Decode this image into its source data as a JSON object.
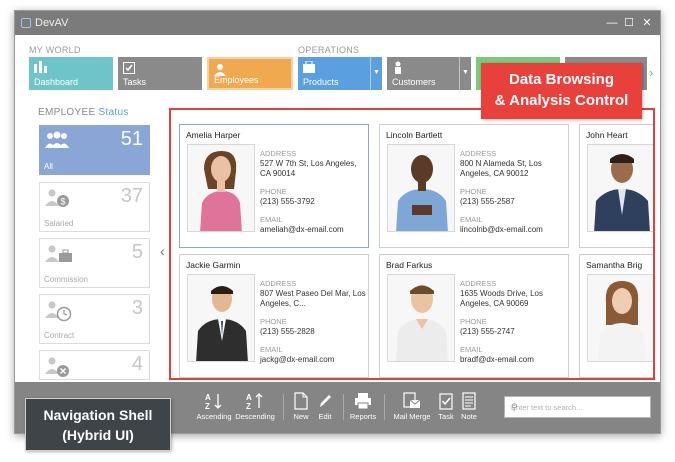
{
  "window": {
    "title": "DevAV",
    "controls": [
      "—",
      "☐",
      "✕"
    ]
  },
  "nav": {
    "groups": {
      "my_world": "MY WORLD",
      "operations": "OPERATIONS"
    },
    "tiles": [
      {
        "label": "Dashboard",
        "icon": "dashboard-icon",
        "color": "#6ec4c8"
      },
      {
        "label": "Tasks",
        "icon": "tasks-icon",
        "color": "#8a8a8a"
      },
      {
        "label": "Employees",
        "icon": "employee-icon",
        "color": "#f0a94e"
      },
      {
        "label": "Products",
        "icon": "products-icon",
        "color": "#5a9fe0"
      },
      {
        "label": "Customers",
        "icon": "customers-icon",
        "color": "#8a8a8a"
      },
      {
        "label": "",
        "icon": "sales-icon",
        "color": "#7cc87c"
      },
      {
        "label": "",
        "icon": "opportunities-icon",
        "color": "#8a8a8a"
      }
    ]
  },
  "status": {
    "title": "EMPLOYEE",
    "subtitle": "Status",
    "items": [
      {
        "label": "All",
        "count": "51",
        "icon": "group-icon"
      },
      {
        "label": "Salaried",
        "count": "37",
        "icon": "salaried-icon"
      },
      {
        "label": "Commission",
        "count": "5",
        "icon": "commission-icon"
      },
      {
        "label": "Contract",
        "count": "3",
        "icon": "contract-icon"
      },
      {
        "label": "",
        "count": "4",
        "icon": "terminated-icon"
      }
    ]
  },
  "cards": [
    {
      "name": "Amelia Harper",
      "address_label": "ADDRESS",
      "address": "527 W 7th St, Los Angeles, CA 90014",
      "phone_label": "PHONE",
      "phone": "(213) 555-3792",
      "email_label": "EMAIL",
      "email": "ameliah@dx-email.com"
    },
    {
      "name": "Lincoln Bartlett",
      "address_label": "ADDRESS",
      "address": "800 N Alameda St, Los Angeles, CA 90012",
      "phone_label": "PHONE",
      "phone": "(213) 555-2587",
      "email_label": "EMAIL",
      "email": "lincolnb@dx-email.com"
    },
    {
      "name": "John Heart",
      "address_label": "",
      "address": "",
      "phone_label": "",
      "phone": "",
      "email_label": "",
      "email": ""
    },
    {
      "name": "Jackie Garmin",
      "address_label": "ADDRESS",
      "address": "807 West Paseo Del Mar, Los Angeles, C...",
      "phone_label": "PHONE",
      "phone": "(213) 555-2828",
      "email_label": "EMAIL",
      "email": "jackg@dx-email.com"
    },
    {
      "name": "Brad Farkus",
      "address_label": "ADDRESS",
      "address": "1635 Woods Drive, Los Angeles, CA 90069",
      "phone_label": "PHONE",
      "phone": "(213) 555-2747",
      "email_label": "EMAIL",
      "email": "bradf@dx-email.com"
    },
    {
      "name": "Samantha Brig",
      "address_label": "",
      "address": "",
      "phone_label": "",
      "phone": "",
      "email_label": "",
      "email": ""
    }
  ],
  "toolbar": {
    "ascending": "Ascending",
    "descending": "Descending",
    "new": "New",
    "edit": "Edit",
    "reports": "Reports",
    "mail_merge": "Mail Merge",
    "task": "Task",
    "note": "Note",
    "search_placeholder": "Enter text to search..."
  },
  "callouts": {
    "browse_line1": "Data Browsing",
    "browse_line2": "& Analysis Control",
    "shell_line1": "Navigation Shell",
    "shell_line2": "(Hybrid UI)"
  }
}
